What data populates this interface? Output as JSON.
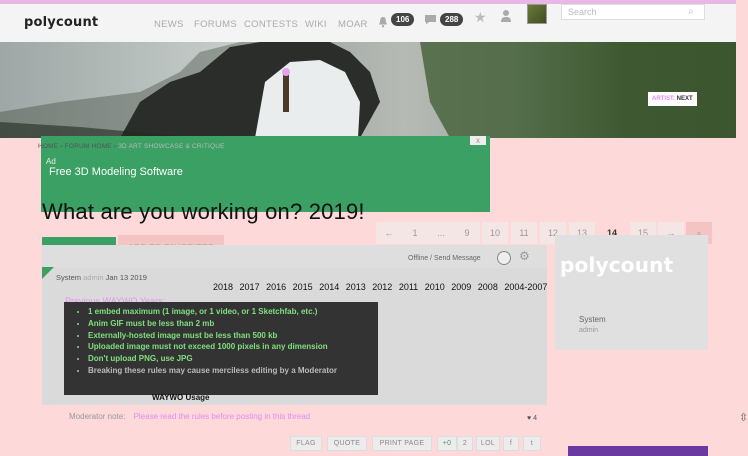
{
  "header": {
    "logo": "polycount",
    "nav": [
      "NEWS",
      "FORUMS",
      "CONTESTS",
      "WIKI",
      "MOAR"
    ],
    "notifications_count": "106",
    "messages_count": "288",
    "search_placeholder": "Search"
  },
  "banner": {
    "prefix": "ARTIST:",
    "next": "NEXT"
  },
  "breadcrumb": [
    "HOME",
    "FORUM HOME",
    "3D ART SHOWCASE & CRITIQUE"
  ],
  "ad": {
    "label": "Ad",
    "text": "Free 3D Modeling Software",
    "close": "x"
  },
  "thread": {
    "title": "What are you working on? 2019!",
    "new_reply": "NEW REPLY",
    "add_favorites": "ADD TO FAVORITES"
  },
  "pagination": [
    "←",
    "1",
    "...",
    "9",
    "10",
    "11",
    "12",
    "13",
    "14",
    "15",
    "→",
    "⌕"
  ],
  "post": {
    "author": "System",
    "role": "admin",
    "date": "Jan 13 2019",
    "status": "Offline / Send Message",
    "years_link": "Previous WAYWO Years:",
    "years": [
      "2018",
      "2017",
      "2016",
      "2015",
      "2014",
      "2013",
      "2012",
      "2011",
      "2010",
      "2009",
      "2008",
      "2004-2007"
    ],
    "rules": [
      "1 embed maximum (1 image, or 1 video, or 1 Sketchfab, etc.)",
      "Anim GIF must be less than 2 mb",
      "Externally-hosted image must be less than 500 kb",
      "Uploaded image must not exceed 1000 pixels in any dimension",
      "Don't upload PNG, use JPG",
      "Breaking these rules may cause merciless editing by a Moderator"
    ],
    "caption": "WAYWO Usage",
    "mod_note_label": "Moderator note:",
    "mod_note": "Please read the rules before posting in this thread",
    "like_count": "4",
    "actions": [
      "FLAG",
      "QUOTE",
      "PRINT PAGE",
      "+0",
      "2",
      "LOL",
      "f",
      "t"
    ]
  },
  "sidebar": {
    "logo": "polycount",
    "name": "System",
    "role": "admin"
  }
}
